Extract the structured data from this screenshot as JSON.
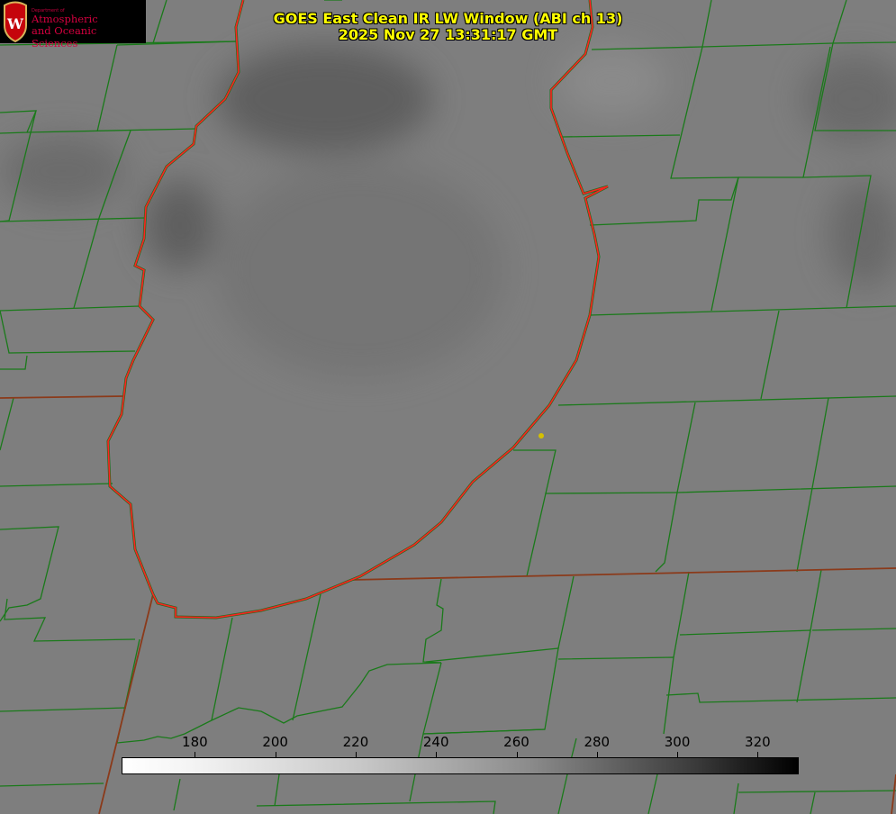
{
  "title": "GOES East Clean IR LW Window (ABI ch 13)",
  "timestamp": "2025 Nov 27 13:31:17 GMT",
  "logo": {
    "dept": "Department of",
    "line1": "Atmospheric",
    "line2": "and Oceanic Sciences",
    "crest_letter": "W"
  },
  "colorbar": {
    "min": 162,
    "max": 330,
    "ticks": [
      "180",
      "200",
      "220",
      "240",
      "260",
      "280",
      "300",
      "320"
    ],
    "colormap": "white-to-black (inverted gray)"
  },
  "colors": {
    "title": "#ffff00",
    "county_lines": "#1a7a1a",
    "lake_outline": "#ff2020",
    "state_lines": "#8b3a1a",
    "marker": "#d4c000"
  }
}
